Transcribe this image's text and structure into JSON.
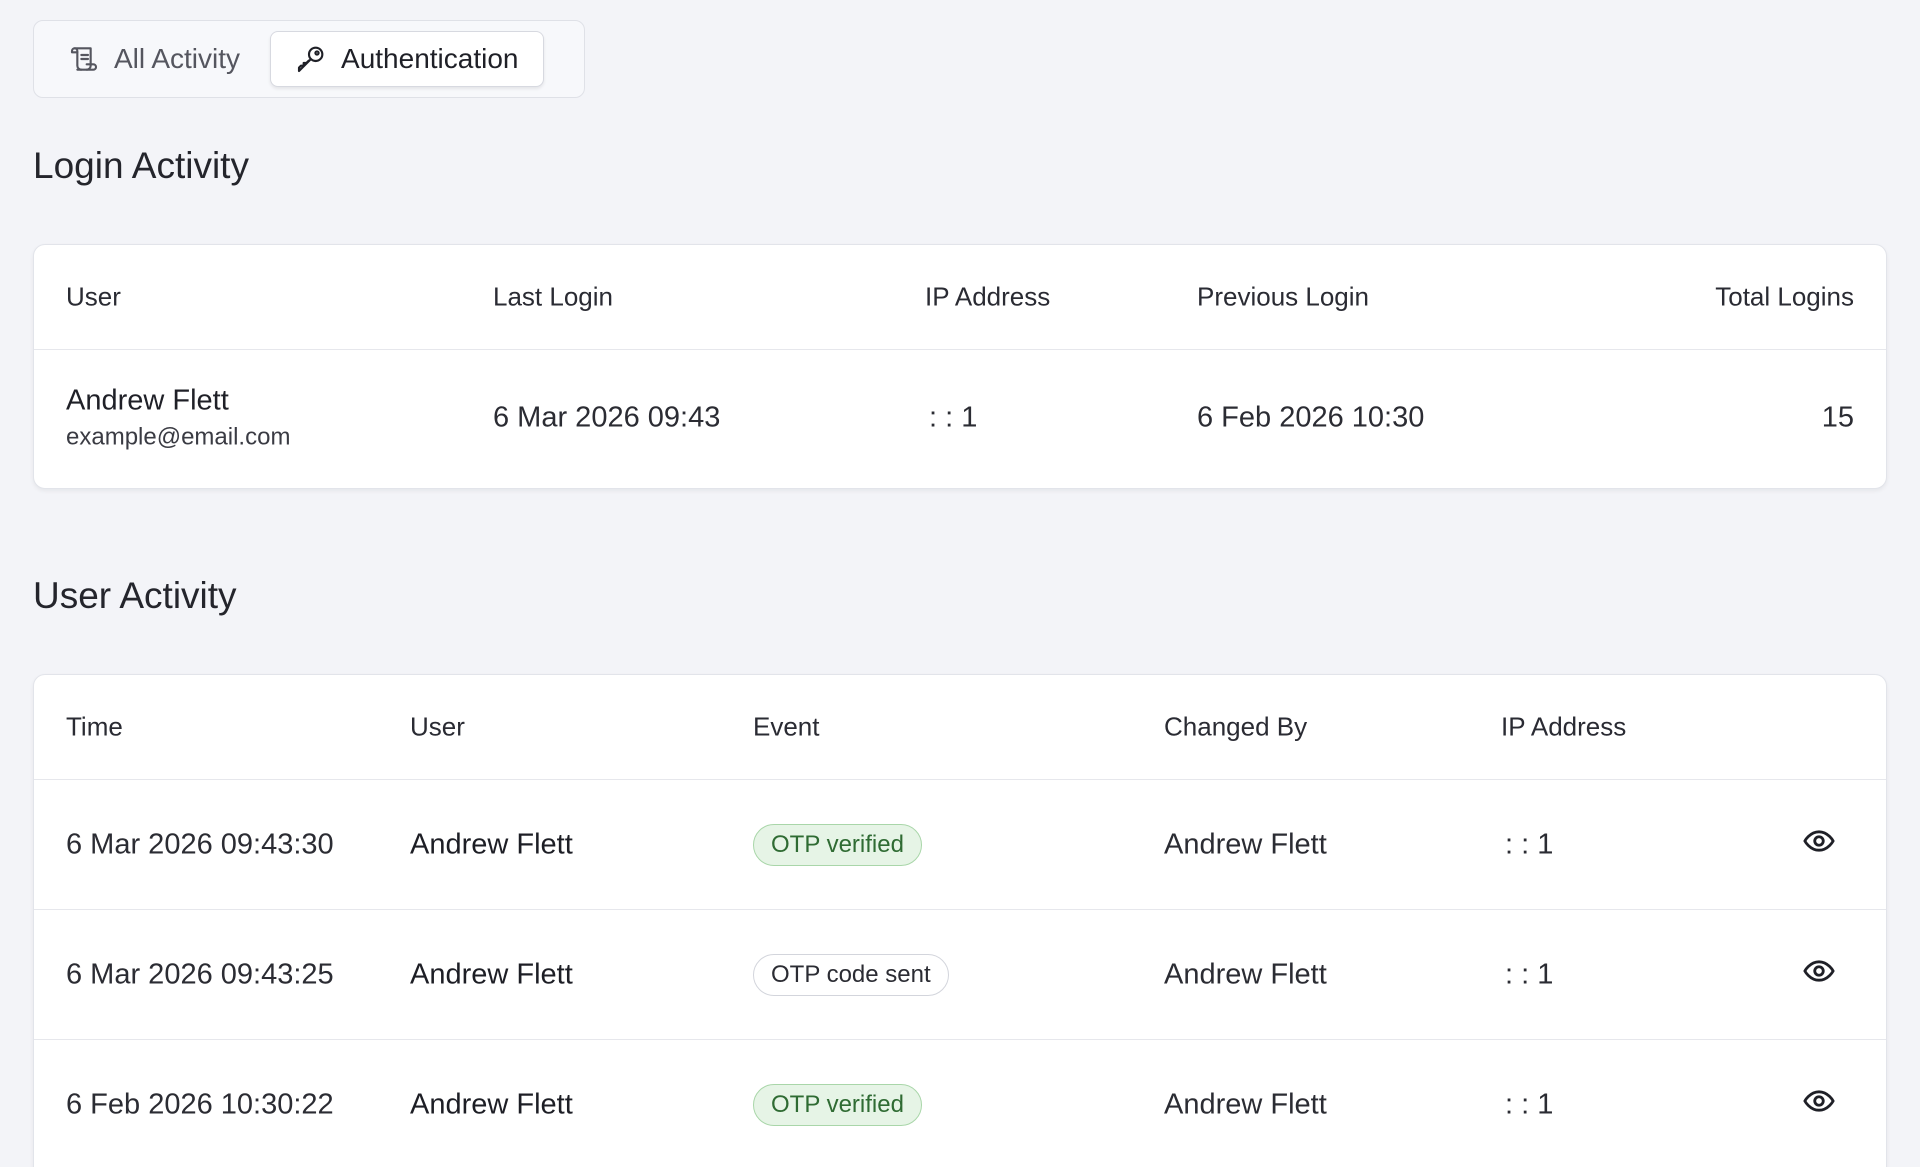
{
  "tabs": [
    {
      "label": "All Activity",
      "icon": "scroll-icon",
      "active": false
    },
    {
      "label": "Authentication",
      "icon": "key-icon",
      "active": true
    }
  ],
  "login_activity": {
    "title": "Login Activity",
    "columns": {
      "user": "User",
      "last_login": "Last Login",
      "ip": "IP Address",
      "previous": "Previous Login",
      "total": "Total Logins"
    },
    "rows": [
      {
        "name": "Andrew Flett",
        "email": "example@email.com",
        "last_login": "6 Mar 2026 09:43",
        "ip": ": : 1",
        "previous": "6 Feb 2026 10:30",
        "total": "15"
      }
    ]
  },
  "user_activity": {
    "title": "User Activity",
    "columns": {
      "time": "Time",
      "user": "User",
      "event": "Event",
      "changed_by": "Changed By",
      "ip": "IP Address"
    },
    "rows": [
      {
        "time": "6 Mar 2026 09:43:30",
        "user": "Andrew Flett",
        "event": "OTP verified",
        "event_style": "success",
        "changed_by": "Andrew Flett",
        "ip": ": : 1",
        "action_icon": "eye-icon"
      },
      {
        "time": "6 Mar 2026 09:43:25",
        "user": "Andrew Flett",
        "event": "OTP code sent",
        "event_style": "neutral",
        "changed_by": "Andrew Flett",
        "ip": ": : 1",
        "action_icon": "eye-icon"
      },
      {
        "time": "6 Feb 2026 10:30:22",
        "user": "Andrew Flett",
        "event": "OTP verified",
        "event_style": "success",
        "changed_by": "Andrew Flett",
        "ip": ": : 1",
        "action_icon": "eye-icon"
      }
    ]
  },
  "colors": {
    "background": "#f3f4f8",
    "success_badge_bg": "#e6f4e6",
    "success_badge_text": "#2f6b33"
  }
}
